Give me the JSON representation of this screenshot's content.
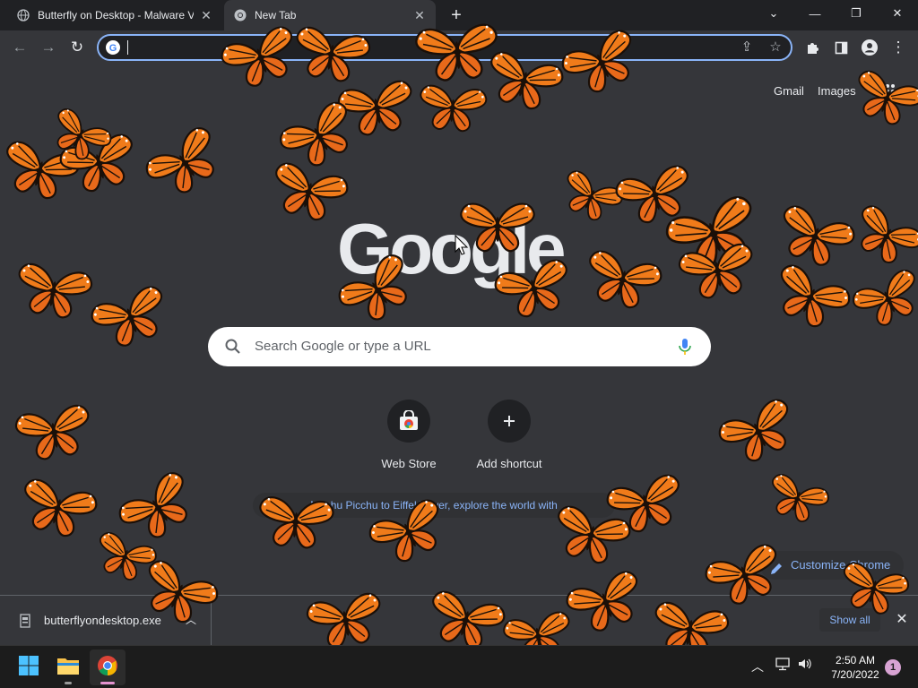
{
  "browser": {
    "tabs": [
      {
        "title": "Butterfly on Desktop - Malware V",
        "active": false
      },
      {
        "title": "New Tab",
        "active": true
      }
    ],
    "new_tab_symbol": "+",
    "window_controls": {
      "list": "⌄",
      "minimize": "—",
      "restore": "❐",
      "close": "✕"
    },
    "toolbar": {
      "back": "←",
      "forward": "→",
      "reload": "↻",
      "omnibox_value": ""
    }
  },
  "ntp": {
    "links": {
      "gmail": "Gmail",
      "images": "Images"
    },
    "logo": "Google",
    "search_placeholder": "Search Google or type a URL",
    "shortcuts": [
      {
        "label": "Web Store",
        "icon": "chrome-web-store-icon"
      },
      {
        "label": "Add shortcut",
        "icon": "plus-icon"
      }
    ],
    "promo_text": "Machu Picchu to Eiffel Tower, explore the world with",
    "customize_label": "Customize Chrome"
  },
  "download_shelf": {
    "file_name": "butterflyondesktop.exe",
    "show_all": "Show all"
  },
  "taskbar": {
    "apps": [
      "start-icon",
      "file-explorer-icon",
      "chrome-icon"
    ],
    "clock_time": "2:50 AM",
    "clock_date": "7/20/2022",
    "notification_count": "1"
  },
  "butterflies": {
    "count": 46,
    "colors": {
      "wing": "#f07b1a",
      "wing_dark": "#c2410c",
      "vein": "#1a0f08",
      "spot": "#ffffff"
    }
  },
  "colors": {
    "frame": "#202124",
    "toolbar": "#35363a",
    "accent": "#8ab4f8",
    "ntp_bg": "#35363a"
  }
}
